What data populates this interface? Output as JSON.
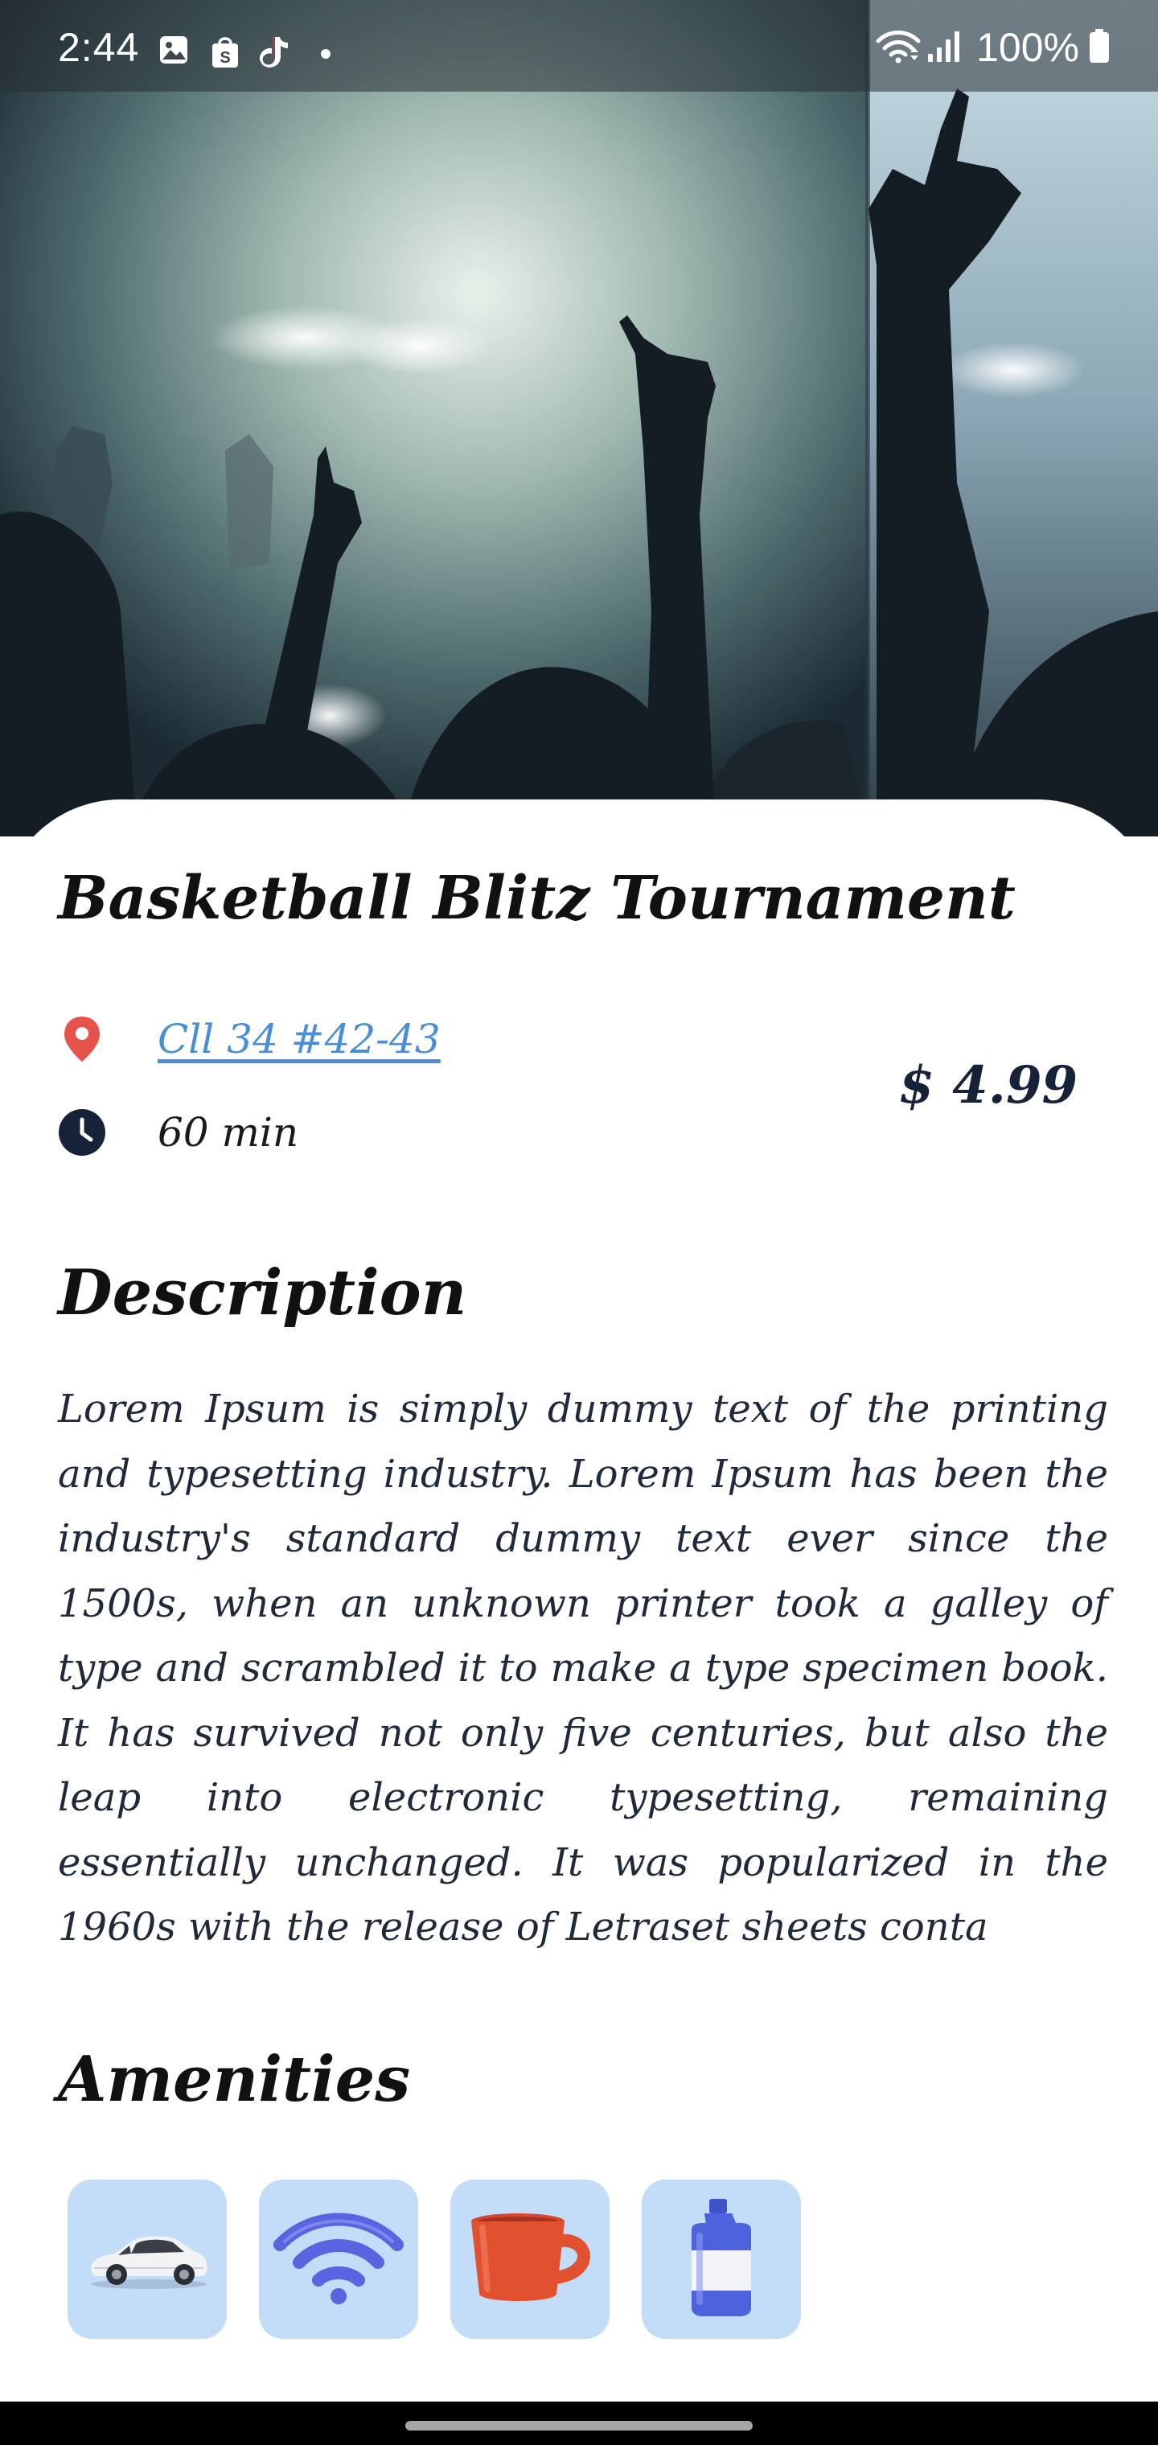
{
  "status_bar": {
    "time": "2:44",
    "battery": "100%",
    "icons": [
      "gallery-icon",
      "shopping-bag-icon",
      "tiktok-icon",
      "notification-dot-icon",
      "wifi-icon",
      "signal-icon",
      "battery-icon"
    ]
  },
  "event": {
    "title": "Basketball Blitz Tournament",
    "address": "Cll 34 #42-43",
    "duration": "60 min",
    "price": "$ 4.99"
  },
  "description": {
    "heading": "Description",
    "body": "Lorem Ipsum is simply dummy text of the printing and typesetting industry. Lorem Ipsum has been the industry's standard dummy text ever since the 1500s, when an unknown printer took a galley of type and scrambled it to make a type specimen book. It has survived not only five centuries, but also the leap into electronic typesetting, remaining essentially unchanged. It was popularized in the 1960s with the release of Letraset sheets conta"
  },
  "amenities": {
    "heading": "Amenities",
    "items": [
      "car-icon",
      "wifi-icon",
      "coffee-mug-icon",
      "water-bottle-icon"
    ]
  },
  "colors": {
    "location_pin": "#e5534b",
    "link": "#4a8fd6",
    "price": "#152238",
    "tile_bg": "#c3dcf7",
    "clock": "#152238"
  }
}
